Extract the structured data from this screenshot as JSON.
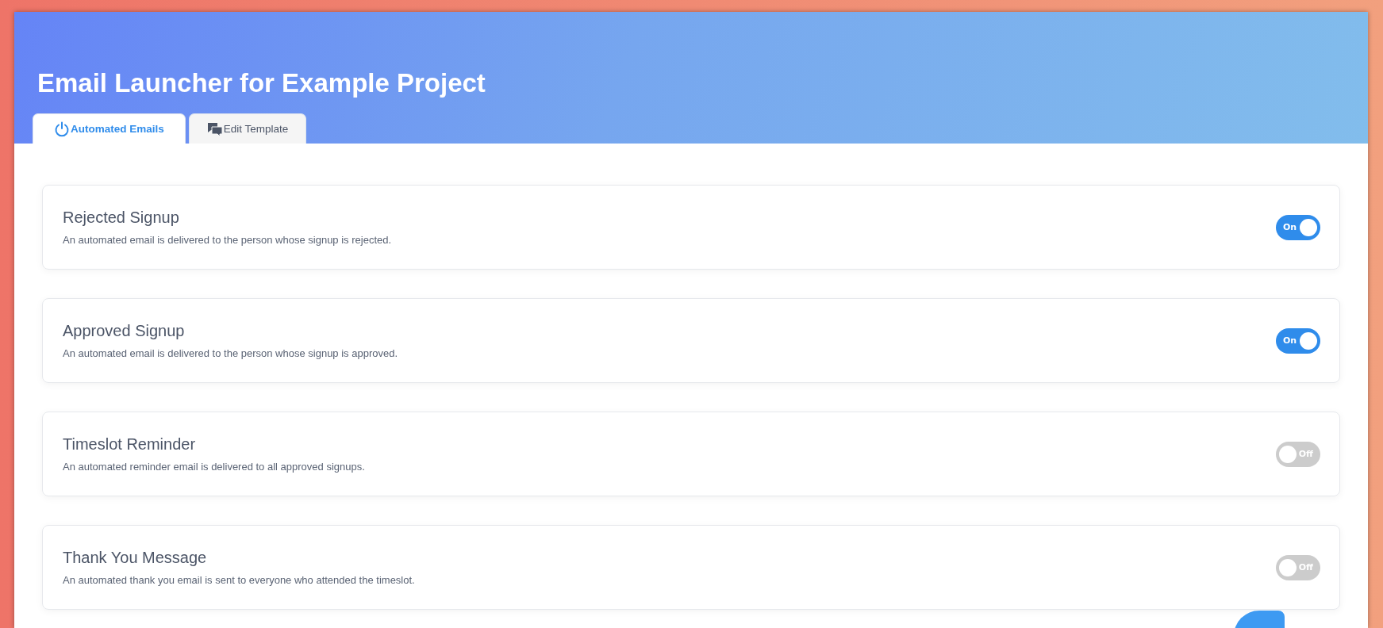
{
  "header": {
    "title": "Email Launcher for Example Project"
  },
  "tabs": [
    {
      "label": "Automated Emails",
      "kind": "power",
      "selected": true
    },
    {
      "label": "Edit Template",
      "kind": "chat",
      "selected": false
    }
  ],
  "emails": [
    {
      "title": "Rejected Signup",
      "description": "An automated email is delivered to the person whose signup is rejected.",
      "on": true,
      "toggle_label": "On"
    },
    {
      "title": "Approved Signup",
      "description": "An automated email is delivered to the person whose signup is approved.",
      "on": true,
      "toggle_label": "On"
    },
    {
      "title": "Timeslot Reminder",
      "description": "An automated reminder email is delivered to all approved signups.",
      "on": false,
      "toggle_label": "Off"
    },
    {
      "title": "Thank You Message",
      "description": "An automated thank you email is sent to everyone who attended the timeslot.",
      "on": false,
      "toggle_label": "Off"
    }
  ]
}
